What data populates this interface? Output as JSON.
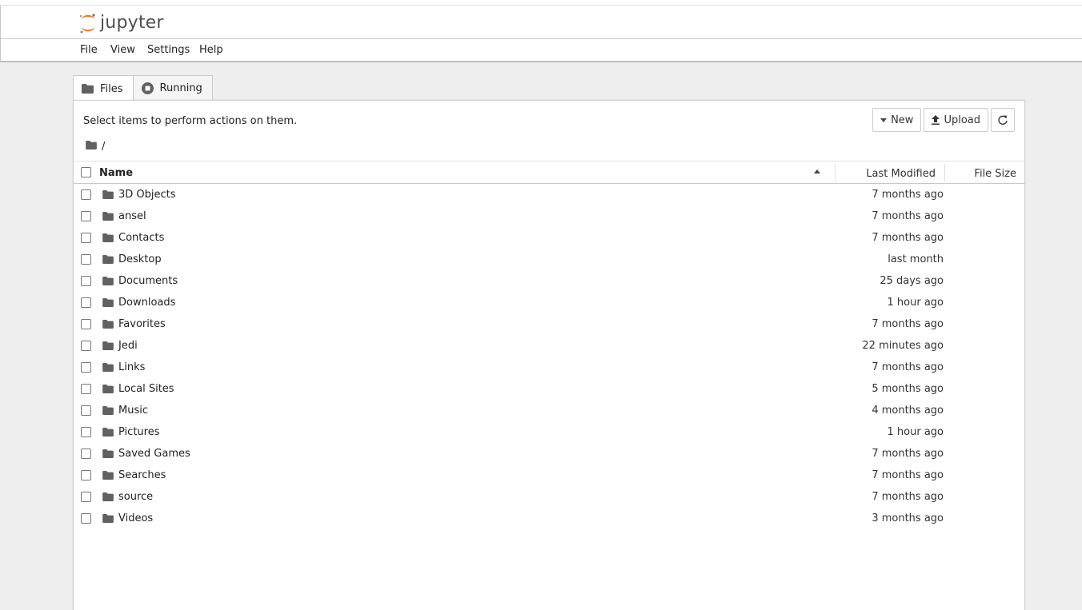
{
  "app": {
    "logo_text": "jupyter"
  },
  "menu": [
    "File",
    "View",
    "Settings",
    "Help"
  ],
  "tabs": [
    {
      "label": "Files",
      "icon": "folder-icon",
      "active": true
    },
    {
      "label": "Running",
      "icon": "stop-circle-icon",
      "active": false
    }
  ],
  "browser": {
    "hint": "Select items to perform actions on them.",
    "breadcrumb": "/",
    "buttons": {
      "new_label": "New",
      "upload_label": "Upload"
    },
    "columns": {
      "name": "Name",
      "last_modified": "Last Modified",
      "file_size": "File Size"
    },
    "items": [
      {
        "name": "3D Objects",
        "modified": "7 months ago"
      },
      {
        "name": "ansel",
        "modified": "7 months ago"
      },
      {
        "name": "Contacts",
        "modified": "7 months ago"
      },
      {
        "name": "Desktop",
        "modified": "last month"
      },
      {
        "name": "Documents",
        "modified": "25 days ago"
      },
      {
        "name": "Downloads",
        "modified": "1 hour ago"
      },
      {
        "name": "Favorites",
        "modified": "7 months ago"
      },
      {
        "name": "Jedi",
        "modified": "22 minutes ago"
      },
      {
        "name": "Links",
        "modified": "7 months ago"
      },
      {
        "name": "Local Sites",
        "modified": "5 months ago"
      },
      {
        "name": "Music",
        "modified": "4 months ago"
      },
      {
        "name": "Pictures",
        "modified": "1 hour ago"
      },
      {
        "name": "Saved Games",
        "modified": "7 months ago"
      },
      {
        "name": "Searches",
        "modified": "7 months ago"
      },
      {
        "name": "source",
        "modified": "7 months ago"
      },
      {
        "name": "Videos",
        "modified": "3 months ago"
      }
    ]
  },
  "colors": {
    "logo_orange": "#f37726",
    "logo_gray": "#767677",
    "folder": "#616161"
  }
}
